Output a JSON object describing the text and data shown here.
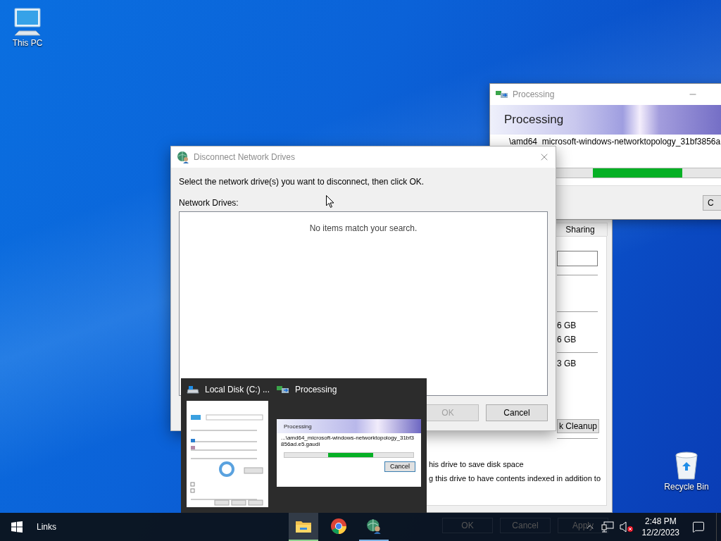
{
  "desktop_icons": [
    {
      "label": "This PC",
      "kind": "computer"
    },
    {
      "label": "Recycle Bin",
      "kind": "recycle"
    }
  ],
  "local_disk_window": {
    "tabs": [
      {
        "label": "Sharing",
        "selected": false
      }
    ],
    "sizes": [
      "6 GB",
      "6 GB",
      "3 GB"
    ],
    "cleanup_button": "k Cleanup",
    "options": [
      "his drive to save disk space",
      "g this drive to have contents indexed in addition to"
    ],
    "buttons": [
      "OK",
      "Cancel",
      "Apply"
    ]
  },
  "processing_window": {
    "title": "Processing",
    "heading": "Processing",
    "path": "\\amd64_microsoft-windows-networktopology_31bf3856a",
    "button": "C"
  },
  "dialog": {
    "title": "Disconnect Network Drives",
    "instruction": "Select the network drive(s) you want to disconnect, then click OK.",
    "list_label": "Network Drives:",
    "empty_message": "No items match your search.",
    "buttons": [
      {
        "label": "OK",
        "disabled": true
      },
      {
        "label": "Cancel",
        "disabled": false
      }
    ]
  },
  "thumbnail_preview": {
    "items": [
      {
        "title": "Local Disk (C:) ...",
        "kind": "drive"
      },
      {
        "title": "Processing",
        "kind": "processing"
      }
    ],
    "mini_processing": {
      "heading": "Processing",
      "path": "...\\amd64_microsoft-windows-networktopology_31bf3856ad.e5.gaudi",
      "button": "Cancel"
    }
  },
  "taskbar": {
    "toolbar_label": "Links",
    "apps": [
      {
        "kind": "explorer",
        "selected": true,
        "running": true
      },
      {
        "kind": "chrome",
        "selected": false,
        "running": false
      },
      {
        "kind": "network",
        "selected": false,
        "running": true
      }
    ],
    "clock": {
      "time": "2:48 PM",
      "date": "12/2/2023"
    }
  }
}
